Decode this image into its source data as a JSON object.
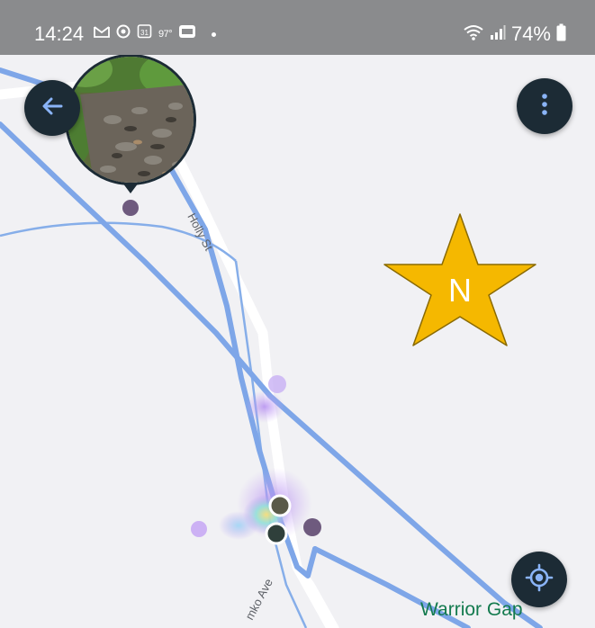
{
  "status_bar": {
    "time": "14:24",
    "temperature": "97°",
    "battery": "74%",
    "icons": [
      "gmail-icon",
      "chrome-icon",
      "calendar-icon",
      "weather-icon",
      "bing-icon",
      "wifi-icon",
      "signal-icon",
      "battery-icon"
    ]
  },
  "map": {
    "street_labels": {
      "holly": "Holly St",
      "avenue": "mko Ave"
    },
    "place_label": "Warrior Gap"
  },
  "north_marker": {
    "letter": "N",
    "color": "#f5b800"
  },
  "buttons": {
    "back_icon": "arrow-left-icon",
    "menu_icon": "more-vertical-icon",
    "locate_icon": "my-location-icon"
  },
  "colors": {
    "map_background": "#f1f1f4",
    "trail_blue": "#7ea6e8",
    "button_dark": "#1c2b35",
    "button_accent": "#8ab4f8",
    "place_green": "#137a4e",
    "marker_purple": "#6e5a7e"
  }
}
